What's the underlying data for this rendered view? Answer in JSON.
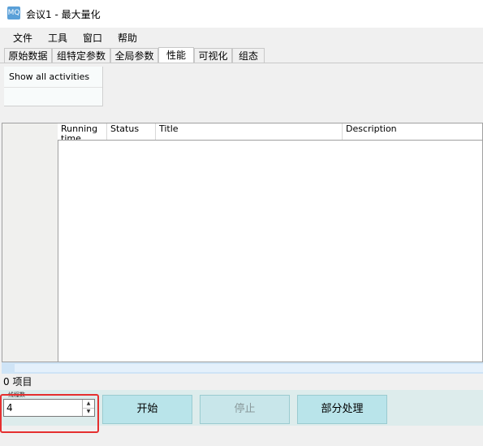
{
  "window": {
    "title": "会议1 - 最大量化",
    "icon": "app-icon"
  },
  "menu": {
    "items": [
      "文件",
      "工具",
      "窗口",
      "帮助"
    ]
  },
  "tabs": [
    {
      "label": "原始数据",
      "active": false
    },
    {
      "label": "组特定参数",
      "active": false
    },
    {
      "label": "全局参数",
      "active": false
    },
    {
      "label": "性能",
      "active": true
    },
    {
      "label": "可视化",
      "active": false
    },
    {
      "label": "组态",
      "active": false
    }
  ],
  "filter": {
    "label": "Show all activities"
  },
  "grid": {
    "columns": [
      "Running time",
      "Status",
      "Title",
      "Description"
    ],
    "rows": []
  },
  "status": {
    "item_count": "0 项目"
  },
  "controls": {
    "threads_label": "线程数",
    "threads_value": "4",
    "start_label": "开始",
    "stop_label": "停止",
    "partial_label": "部分处理",
    "stop_disabled": true
  },
  "colors": {
    "button_bg": "#b9e4ea",
    "highlight": "#e53030",
    "scrollbar": "#cfe4f6"
  }
}
